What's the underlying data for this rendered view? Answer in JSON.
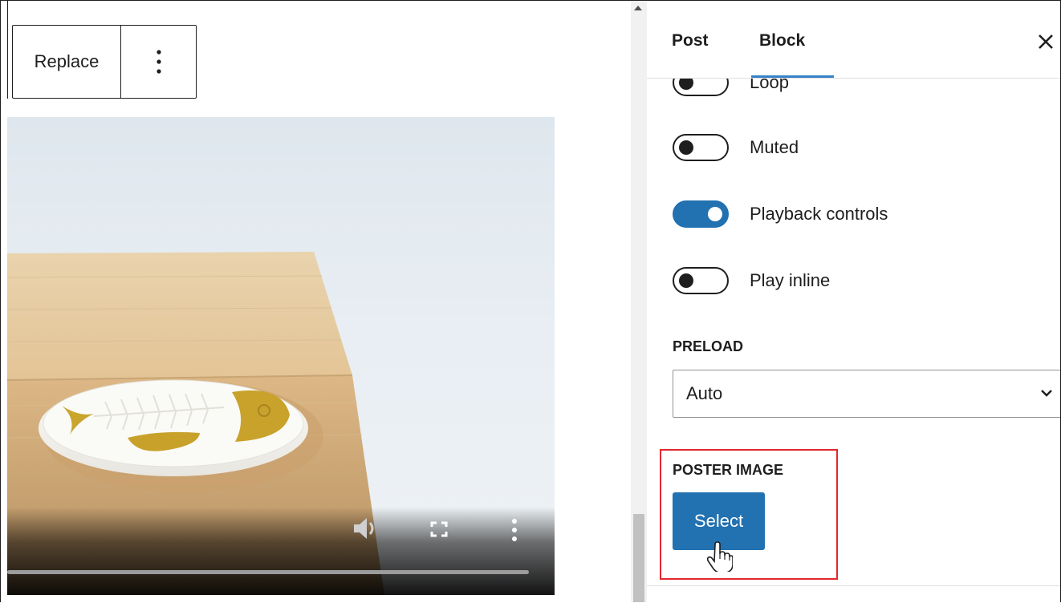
{
  "toolbar": {
    "replace_label": "Replace",
    "more_icon": "more-vertical-icon"
  },
  "video": {
    "controls": {
      "volume_icon": "volume-icon",
      "fullscreen_icon": "fullscreen-icon",
      "menu_icon": "more-vertical-icon"
    }
  },
  "sidebar": {
    "tabs": [
      {
        "label": "Post"
      },
      {
        "label": "Block"
      }
    ],
    "active_tab": "Block",
    "close_icon": "close-icon",
    "toggles": [
      {
        "label": "Loop",
        "on": false
      },
      {
        "label": "Muted",
        "on": false
      },
      {
        "label": "Playback controls",
        "on": true
      },
      {
        "label": "Play inline",
        "on": false
      }
    ],
    "preload": {
      "label": "PRELOAD",
      "value": "Auto"
    },
    "poster": {
      "label": "POSTER IMAGE",
      "button_label": "Select"
    }
  },
  "colors": {
    "accent": "#2271b1",
    "highlight_box": "#e0282e",
    "tab_indicator": "#3582c4"
  }
}
